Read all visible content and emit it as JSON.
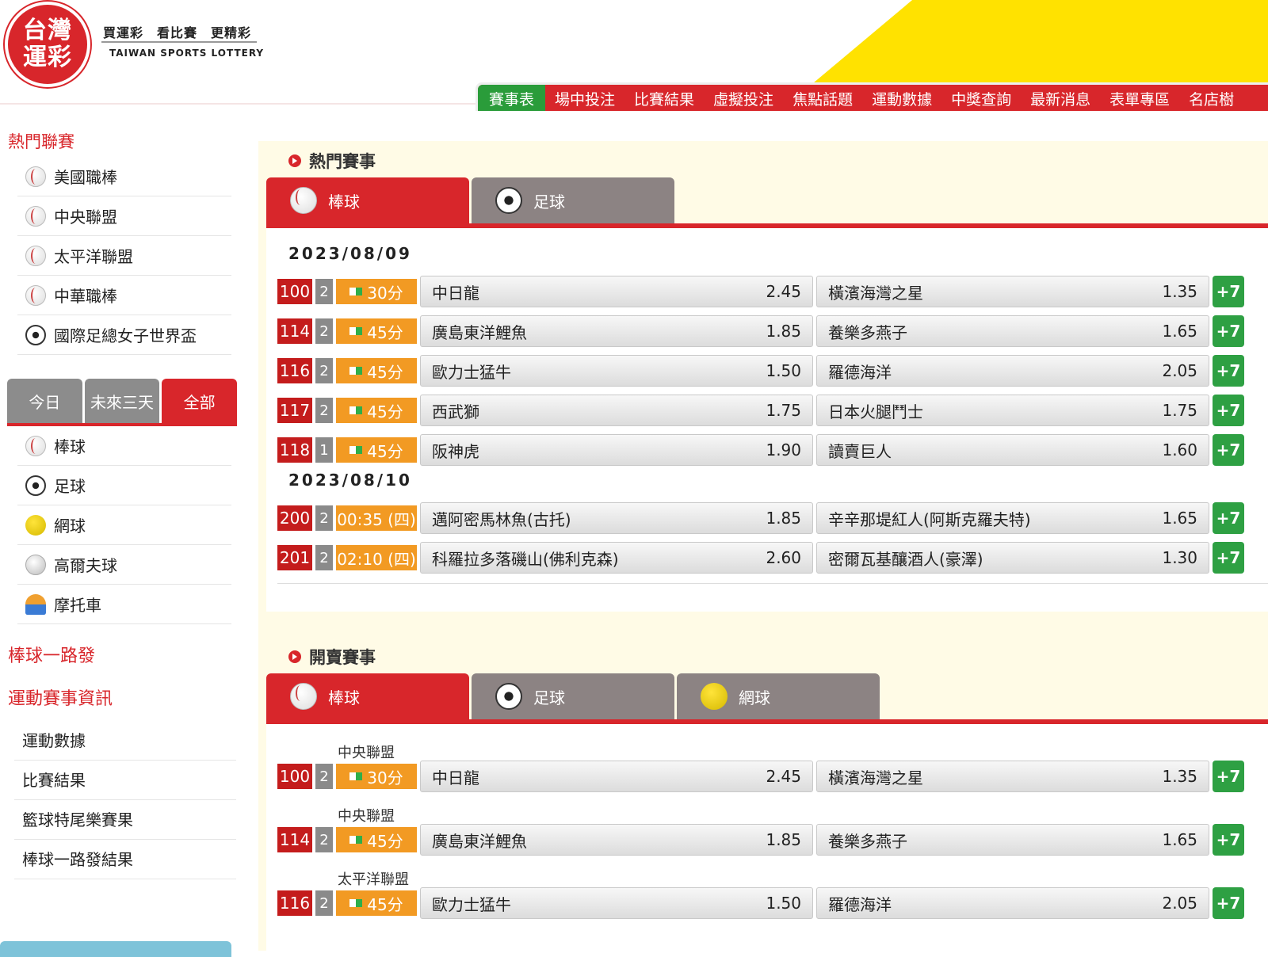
{
  "header": {
    "logo_line1": "台灣",
    "logo_line2": "運彩",
    "slogan": "買運彩　看比賽　更精彩",
    "logo_en": "TAIWAN SPORTS LOTTERY"
  },
  "nav": {
    "items": [
      "賽事表",
      "場中投注",
      "比賽結果",
      "虛擬投注",
      "焦點話題",
      "運動數據",
      "中獎查詢",
      "最新消息",
      "表單專區",
      "名店樹"
    ],
    "active": "賽事表"
  },
  "sidebar": {
    "hot_title": "熱門聯賽",
    "hot_leagues": [
      {
        "label": "美國職棒",
        "icon": "baseball-icon"
      },
      {
        "label": "中央聯盟",
        "icon": "baseball-icon"
      },
      {
        "label": "太平洋聯盟",
        "icon": "baseball-icon"
      },
      {
        "label": "中華職棒",
        "icon": "baseball-icon"
      },
      {
        "label": "國際足總女子世界盃",
        "icon": "soccer-ball-icon"
      }
    ],
    "day_tabs": [
      "今日",
      "未來三天",
      "全部"
    ],
    "day_tab_active": "全部",
    "sports": [
      {
        "label": "棒球",
        "icon": "baseball-icon"
      },
      {
        "label": "足球",
        "icon": "soccer-ball-icon"
      },
      {
        "label": "網球",
        "icon": "tennis-ball-icon"
      },
      {
        "label": "高爾夫球",
        "icon": "golf-ball-icon"
      },
      {
        "label": "摩托車",
        "icon": "motorcycle-helmet-icon"
      }
    ],
    "link_baseball": "棒球一路發",
    "info_title": "運動賽事資訊",
    "info_links": [
      "運動數據",
      "比賽結果",
      "籃球特尾樂賽果",
      "棒球一路發結果"
    ]
  },
  "hot": {
    "title": "熱門賽事",
    "tabs": [
      {
        "label": "棒球",
        "icon": "baseball-icon"
      },
      {
        "label": "足球",
        "icon": "soccer-ball-icon"
      }
    ],
    "groups": [
      {
        "date": "2023/08/09",
        "matches": [
          {
            "num": "100",
            "cnt": "2",
            "time": "30分",
            "live": true,
            "home": "中日龍",
            "home_odds": "2.45",
            "away": "橫濱海灣之星",
            "away_odds": "1.35",
            "more": "+7"
          },
          {
            "num": "114",
            "cnt": "2",
            "time": "45分",
            "live": true,
            "home": "廣島東洋鯉魚",
            "home_odds": "1.85",
            "away": "養樂多燕子",
            "away_odds": "1.65",
            "more": "+7"
          },
          {
            "num": "116",
            "cnt": "2",
            "time": "45分",
            "live": true,
            "home": "歐力士猛牛",
            "home_odds": "1.50",
            "away": "羅德海洋",
            "away_odds": "2.05",
            "more": "+7"
          },
          {
            "num": "117",
            "cnt": "2",
            "time": "45分",
            "live": true,
            "home": "西武獅",
            "home_odds": "1.75",
            "away": "日本火腿鬥士",
            "away_odds": "1.75",
            "more": "+7"
          },
          {
            "num": "118",
            "cnt": "1",
            "time": "45分",
            "live": true,
            "home": "阪神虎",
            "home_odds": "1.90",
            "away": "讀賣巨人",
            "away_odds": "1.60",
            "more": "+7"
          }
        ]
      },
      {
        "date": "2023/08/10",
        "matches": [
          {
            "num": "200",
            "cnt": "2",
            "time": "00:35 (四)",
            "live": false,
            "home": "邁阿密馬林魚(古托)",
            "home_odds": "1.85",
            "away": "辛辛那堤紅人(阿斯克羅夫特)",
            "away_odds": "1.65",
            "more": "+7"
          },
          {
            "num": "201",
            "cnt": "2",
            "time": "02:10 (四)",
            "live": false,
            "home": "科羅拉多落磯山(佛利克森)",
            "home_odds": "2.60",
            "away": "密爾瓦基釀酒人(豪澤)",
            "away_odds": "1.30",
            "more": "+7"
          }
        ]
      }
    ]
  },
  "onsale": {
    "title": "開賣賽事",
    "tabs": [
      {
        "label": "棒球",
        "icon": "baseball-icon"
      },
      {
        "label": "足球",
        "icon": "soccer-ball-icon"
      },
      {
        "label": "網球",
        "icon": "tennis-ball-icon"
      }
    ],
    "matches": [
      {
        "league": "中央聯盟",
        "num": "100",
        "cnt": "2",
        "time": "30分",
        "live": true,
        "home": "中日龍",
        "home_odds": "2.45",
        "away": "橫濱海灣之星",
        "away_odds": "1.35",
        "more": "+7"
      },
      {
        "league": "中央聯盟",
        "num": "114",
        "cnt": "2",
        "time": "45分",
        "live": true,
        "home": "廣島東洋鯉魚",
        "home_odds": "1.85",
        "away": "養樂多燕子",
        "away_odds": "1.65",
        "more": "+7"
      },
      {
        "league": "太平洋聯盟",
        "num": "116",
        "cnt": "2",
        "time": "45分",
        "live": true,
        "home": "歐力士猛牛",
        "home_odds": "1.50",
        "away": "羅德海洋",
        "away_odds": "2.05",
        "more": "+7"
      }
    ]
  }
}
